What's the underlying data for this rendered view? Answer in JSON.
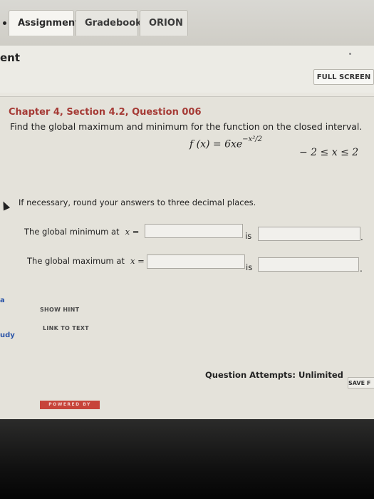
{
  "tabs": [
    {
      "label": "Assignment",
      "active": true
    },
    {
      "label": "Gradebook",
      "active": false
    },
    {
      "label": "ORION",
      "active": false
    }
  ],
  "page_title": "ent",
  "full_screen_label": "FULL SCREEN",
  "question": {
    "heading": "Chapter 4, Section 4.2, Question 006",
    "prompt": "Find the global maximum and minimum for the function on the closed interval.",
    "function_lhs": "f (x) = 6xe",
    "function_exponent": "−x²/2",
    "interval": "− 2 ≤ x ≤ 2",
    "rounding_note": "If necessary, round your answers to three decimal places.",
    "min_label": "The global minimum at",
    "max_label": "The global maximum at",
    "x_equals": "x =",
    "is_label": "is",
    "min_x_value": "",
    "min_value": "",
    "max_x_value": "",
    "max_value": "",
    "period": "."
  },
  "links": {
    "show_hint": "SHOW HINT",
    "link_to_text": "LINK TO TEXT"
  },
  "left_stubs": {
    "a": "a",
    "b": "udy"
  },
  "attempts": "Question Attempts: Unlimited",
  "save_label": "SAVE F",
  "powered_by": "POWERED BY",
  "colors": {
    "heading": "#a53a35",
    "powered_bg": "#c7443a"
  }
}
